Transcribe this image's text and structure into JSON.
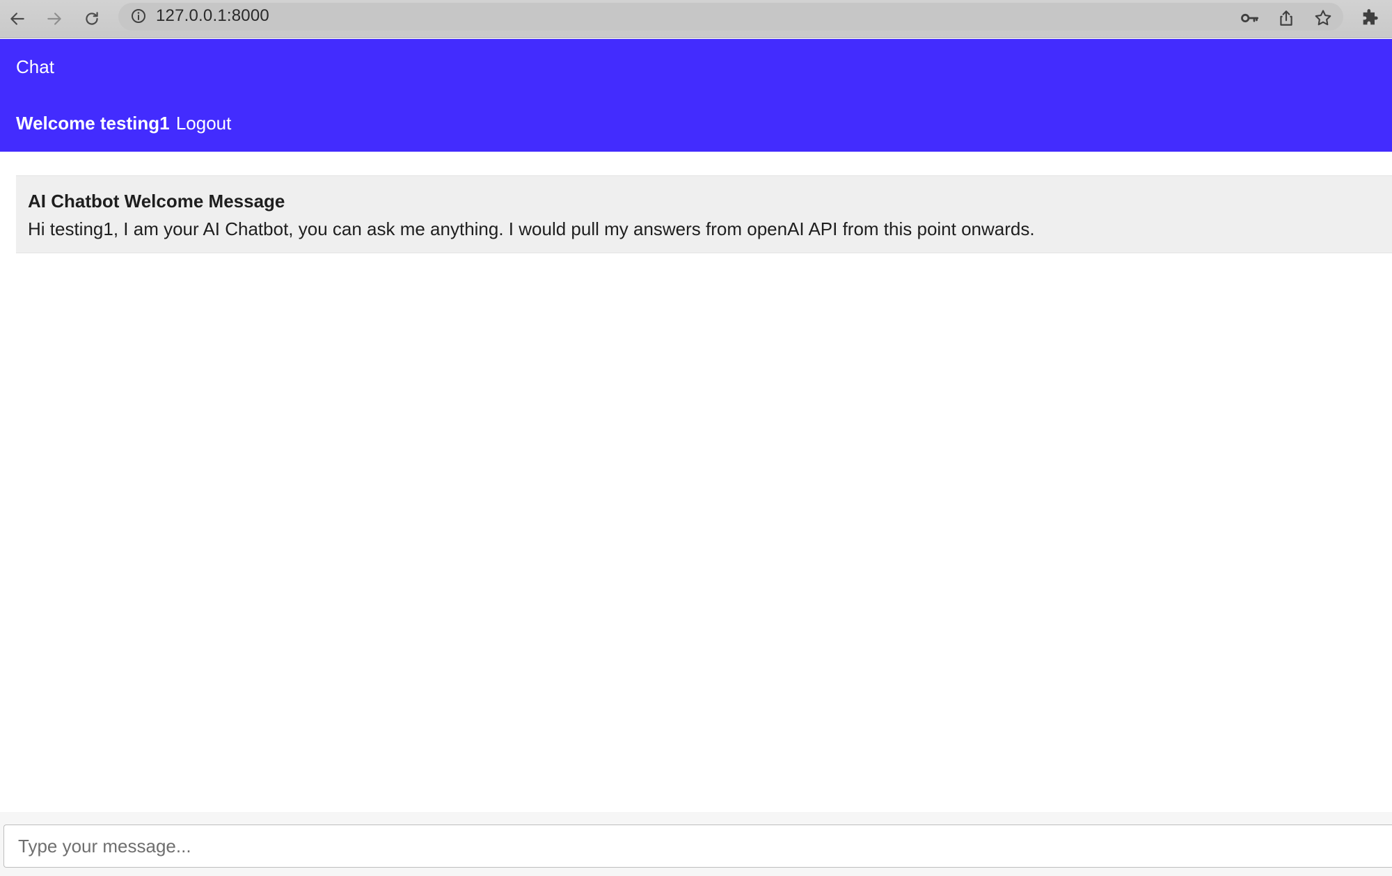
{
  "browser": {
    "url": "127.0.0.1:8000"
  },
  "header": {
    "title": "Chat",
    "welcome": "Welcome testing1",
    "logout_label": "Logout"
  },
  "messages": [
    {
      "title": "AI Chatbot Welcome Message",
      "body": "Hi testing1, I am your AI Chatbot, you can ask me anything. I would pull my answers from openAI API from this point onwards."
    }
  ],
  "composer": {
    "placeholder": "Type your message..."
  },
  "colors": {
    "header_bg": "#432cfe",
    "header_text": "#ffffff",
    "message_bg": "#efefef"
  },
  "icons": {
    "back": "arrow-left-icon",
    "forward": "arrow-right-icon",
    "reload": "reload-icon",
    "site_info": "info-icon",
    "password": "key-icon",
    "share": "share-icon",
    "bookmark": "star-icon",
    "extensions": "puzzle-icon"
  }
}
